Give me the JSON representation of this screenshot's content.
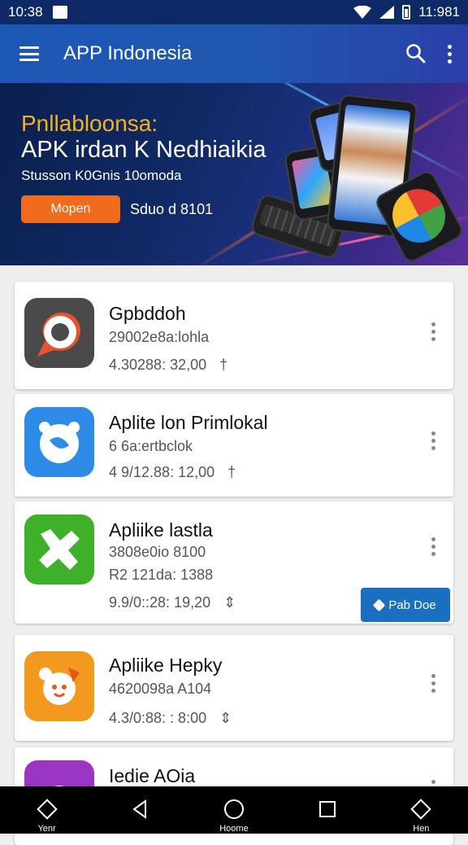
{
  "status_bar": {
    "time_left": "10:38",
    "time_right": "11:981"
  },
  "app_bar": {
    "title": "APP Indonesia"
  },
  "banner": {
    "kicker": "Pnllablοonsa:",
    "title": "APK irdan K Nedhiaikia",
    "subtitle": "Stusson K0Gnis 10omoda",
    "button_label": "Mopen",
    "date": "Sduo d 8101"
  },
  "apps": [
    {
      "name": "Gpbddoh",
      "meta": "29002e8a:lohla",
      "date": "4.30288: 32,00",
      "icon_color": "#4a4a4a"
    },
    {
      "name": "Aplite lon Primlokal",
      "meta": "6 6a:ertbclok",
      "date": "4 9/12.88: 12,00",
      "icon_color": "#2e8ce8"
    },
    {
      "name": "Apliike lastla",
      "meta": "3808e0io 8100",
      "extra": "R2 121da: 1388",
      "date": "9.9/0::28: 19,20",
      "icon_color": "#3fb029",
      "follow_label": "Pab Doe"
    },
    {
      "name": "Apliike Hepky",
      "meta": "4620098a A104",
      "date": "4.3/0:88: : 8:00",
      "icon_color": "#f39a1e"
    },
    {
      "name": "Iedie AOia",
      "icon_color": "#9b35c4"
    }
  ],
  "nav": {
    "items": [
      {
        "label": "Yenr",
        "icon": "diamond-icon"
      },
      {
        "label": "",
        "icon": "back-triangle-icon"
      },
      {
        "label": "Hoome",
        "icon": "home-circle-icon"
      },
      {
        "label": "",
        "icon": "recents-square-icon"
      },
      {
        "label": "Hen",
        "icon": "diamond-icon"
      }
    ]
  }
}
